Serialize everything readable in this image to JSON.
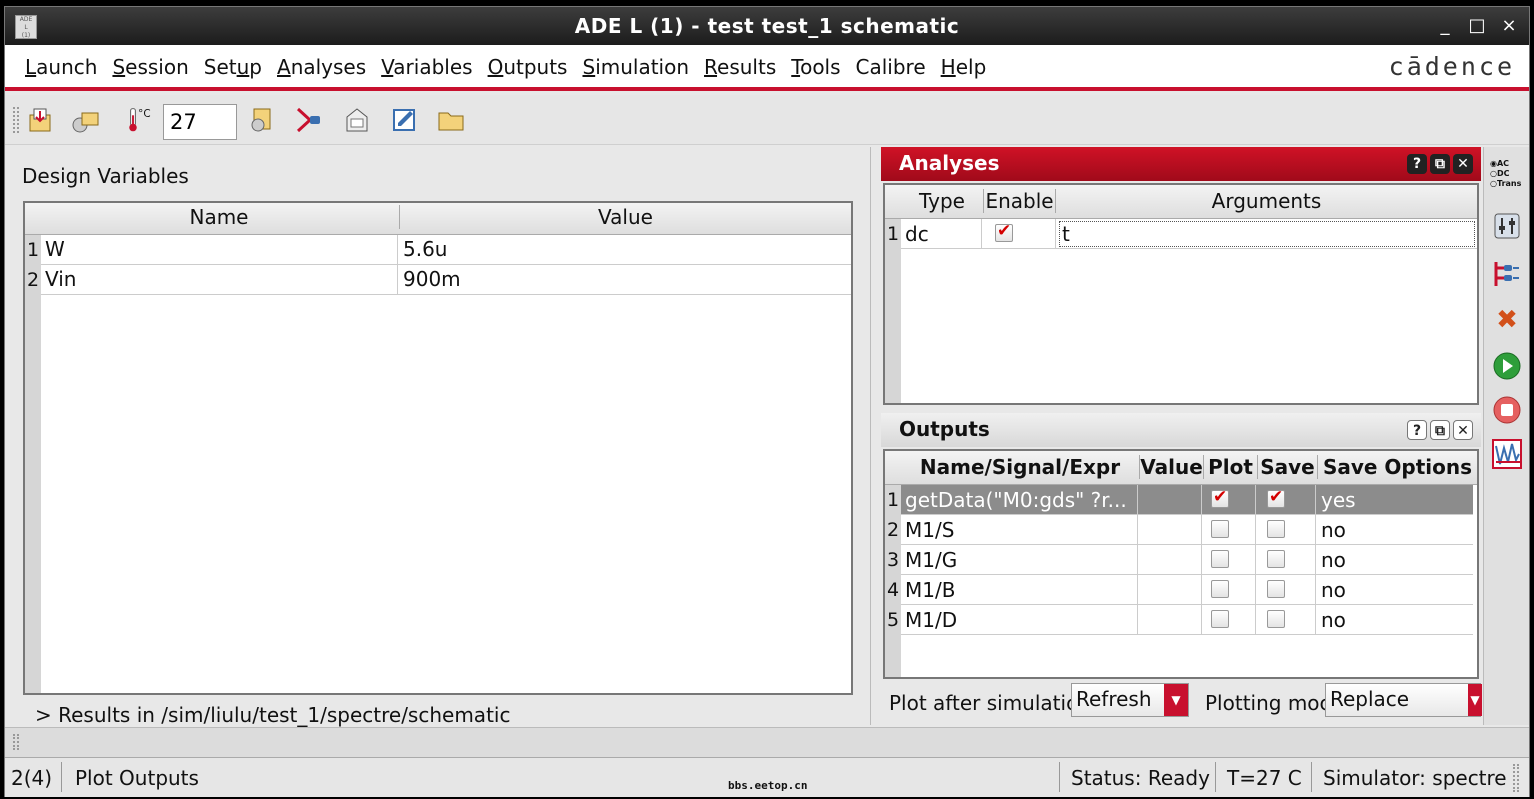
{
  "window": {
    "title": "ADE L (1) - test test_1 schematic",
    "controls": {
      "minimize": "_",
      "maximize": "□",
      "close": "×"
    }
  },
  "menu": {
    "items": [
      {
        "pre": "",
        "u": "L",
        "post": "aunch"
      },
      {
        "pre": "",
        "u": "S",
        "post": "ession"
      },
      {
        "pre": "Set",
        "u": "u",
        "post": "p"
      },
      {
        "pre": "",
        "u": "A",
        "post": "nalyses"
      },
      {
        "pre": "",
        "u": "V",
        "post": "ariables"
      },
      {
        "pre": "",
        "u": "O",
        "post": "utputs"
      },
      {
        "pre": "",
        "u": "S",
        "post": "imulation"
      },
      {
        "pre": "",
        "u": "R",
        "post": "esults"
      },
      {
        "pre": "",
        "u": "T",
        "post": "ools"
      },
      {
        "pre": "Calibre",
        "u": "",
        "post": ""
      },
      {
        "pre": "",
        "u": "H",
        "post": "elp"
      }
    ],
    "brand": "cādence"
  },
  "toolbar": {
    "temperature_unit": "°C",
    "temperature_value": "27"
  },
  "design_variables": {
    "label": "Design Variables",
    "columns": [
      "Name",
      "Value"
    ],
    "rows": [
      {
        "idx": "1",
        "name": "W",
        "value": "5.6u"
      },
      {
        "idx": "2",
        "name": "Vin",
        "value": "900m"
      }
    ],
    "results_line": "> Results in /sim/liulu/test_1/spectre/schematic"
  },
  "analyses": {
    "title": "Analyses",
    "columns": [
      "Type",
      "Enable",
      "Arguments"
    ],
    "rows": [
      {
        "idx": "1",
        "type": "dc",
        "enabled": true,
        "args": "t"
      }
    ]
  },
  "outputs": {
    "title": "Outputs",
    "columns": [
      "Name/Signal/Expr",
      "Value",
      "Plot",
      "Save",
      "Save Options"
    ],
    "rows": [
      {
        "idx": "1",
        "name": "getData(\"M0:gds\" ?r...",
        "value": "",
        "plot": true,
        "save": true,
        "opts": "yes"
      },
      {
        "idx": "2",
        "name": "M1/S",
        "value": "",
        "plot": false,
        "save": false,
        "opts": "no"
      },
      {
        "idx": "3",
        "name": "M1/G",
        "value": "",
        "plot": false,
        "save": false,
        "opts": "no"
      },
      {
        "idx": "4",
        "name": "M1/B",
        "value": "",
        "plot": false,
        "save": false,
        "opts": "no"
      },
      {
        "idx": "5",
        "name": "M1/D",
        "value": "",
        "plot": false,
        "save": false,
        "opts": "no"
      }
    ],
    "plot_after_label": "Plot after simulatic",
    "plot_after_value": "Refresh",
    "plotting_mode_label": "Plotting moc",
    "plotting_mode_value": "Replace"
  },
  "vtools": {
    "mini_radio": [
      "AC",
      "DC",
      "Trans"
    ]
  },
  "status": {
    "counter": "2(4)",
    "message": "Plot Outputs",
    "state": "Status: Ready",
    "temp": "T=27 C",
    "simulator": "Simulator: spectre"
  },
  "watermark": "bbs.eetop.cn"
}
